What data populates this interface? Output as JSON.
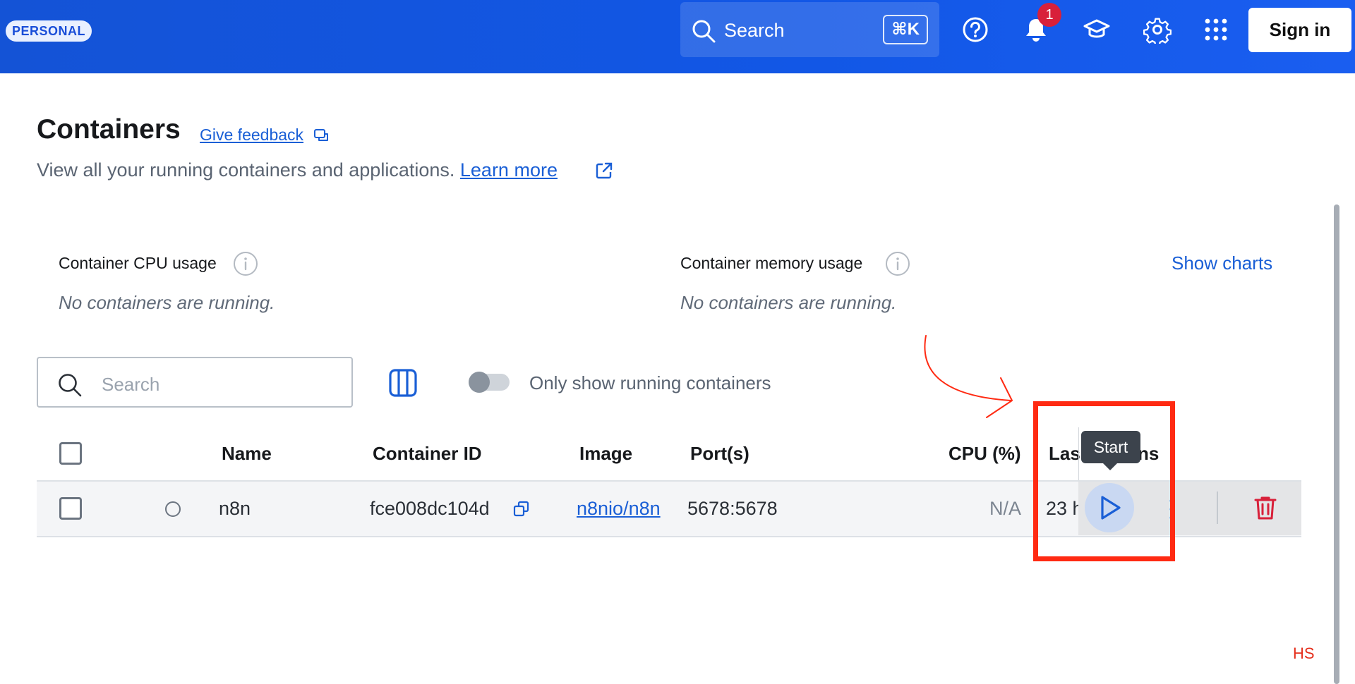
{
  "header": {
    "personal_badge": "PERSONAL",
    "search_placeholder": "Search",
    "search_shortcut": "⌘K",
    "notification_count": "1",
    "sign_in_label": "Sign in",
    "icons": [
      "search-icon",
      "help-icon",
      "bell-icon",
      "learning-center-icon",
      "settings-icon",
      "apps-grid-icon"
    ]
  },
  "page": {
    "title": "Containers",
    "feedback_label": "Give feedback",
    "subtitle": "View all your running containers and applications.",
    "learn_more_label": "Learn more"
  },
  "usage": {
    "cpu_label": "Container CPU usage",
    "cpu_empty": "No containers are running.",
    "memory_label": "Container memory usage",
    "memory_empty": "No containers are running.",
    "show_charts_label": "Show charts"
  },
  "toolbar": {
    "search_placeholder": "Search",
    "running_toggle_label": "Only show running containers",
    "running_toggle_on": false
  },
  "table": {
    "columns": {
      "name": "Name",
      "container_id": "Container ID",
      "image": "Image",
      "ports": "Port(s)",
      "cpu": "CPU (%)",
      "last_started": "Las",
      "actions": "ns"
    },
    "rows": [
      {
        "name": "n8n",
        "container_id": "fce008dc104d",
        "image": "n8nio/n8n",
        "ports": "5678:5678",
        "cpu": "N/A",
        "last_started": "23 h"
      }
    ]
  },
  "tooltip": {
    "text": "Start"
  },
  "annotation": {
    "mark": "HS",
    "color": "#ff2a12"
  },
  "colors": {
    "brand": "#1257e6",
    "link": "#1a5fd6",
    "danger": "#d8203a"
  }
}
